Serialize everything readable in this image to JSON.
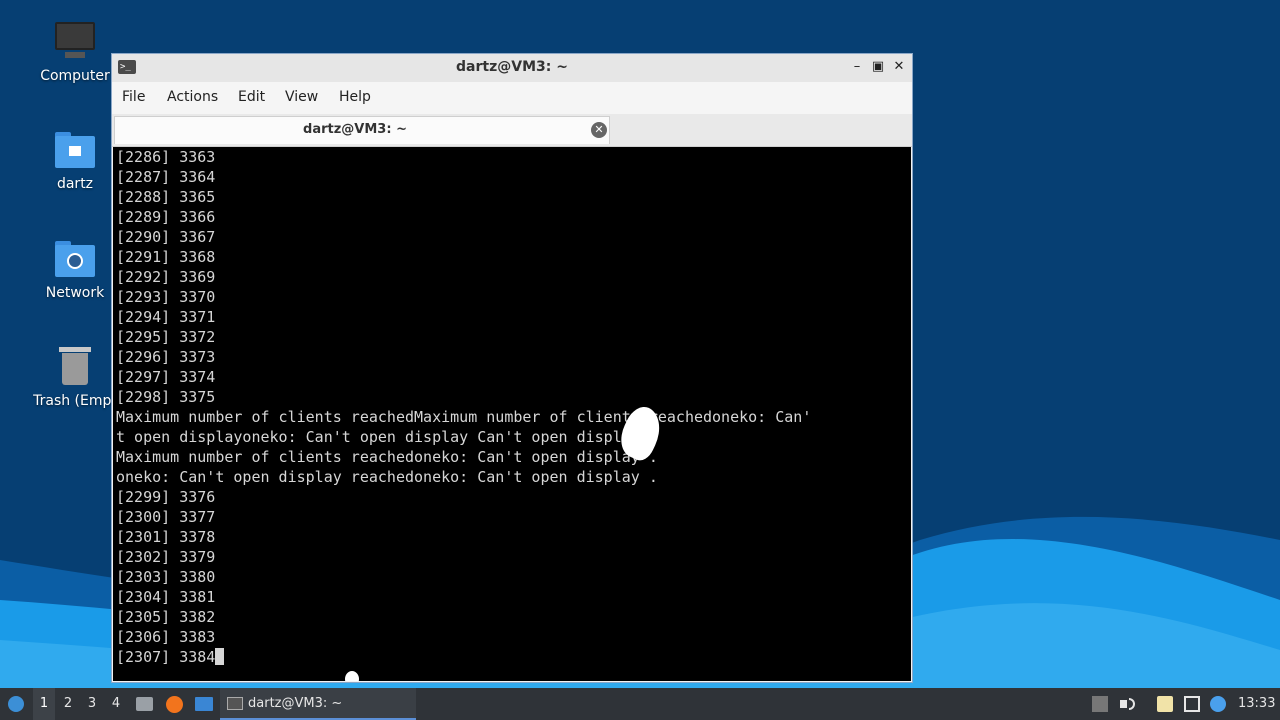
{
  "desktop": {
    "icons": [
      {
        "label": "Computer",
        "icon": "computer-icon"
      },
      {
        "label": "dartz",
        "icon": "home-folder-icon"
      },
      {
        "label": "Network",
        "icon": "network-folder-icon"
      },
      {
        "label": "Trash (Empt",
        "icon": "trash-icon"
      }
    ]
  },
  "window": {
    "title": "dartz@VM3: ~",
    "menu": [
      "File",
      "Actions",
      "Edit",
      "View",
      "Help"
    ],
    "tab_title": "dartz@VM3: ~"
  },
  "terminal": {
    "lines": [
      "[2286] 3363",
      "[2287] 3364",
      "[2288] 3365",
      "[2289] 3366",
      "[2290] 3367",
      "[2291] 3368",
      "[2292] 3369",
      "[2293] 3370",
      "[2294] 3371",
      "[2295] 3372",
      "[2296] 3373",
      "[2297] 3374",
      "[2298] 3375",
      "Maximum number of clients reachedMaximum number of clients reachedoneko: Can'",
      "t open displayoneko: Can't open display Can't open display .",
      "Maximum number of clients reachedoneko: Can't open display .",
      "oneko: Can't open display reachedoneko: Can't open display .",
      "[2299] 3376",
      "[2300] 3377",
      "[2301] 3378",
      "[2302] 3379",
      "[2303] 3380",
      "[2304] 3381",
      "[2305] 3382",
      "[2306] 3383",
      "[2307] 3384"
    ]
  },
  "taskbar": {
    "workspaces": [
      "1",
      "2",
      "3",
      "4"
    ],
    "active_workspace": "1",
    "task_label": "dartz@VM3: ~",
    "clock": "13:33"
  },
  "colors": {
    "desktop_bg": "#063f73",
    "wave_light": "#1a9be8",
    "terminal_bg": "#000000",
    "terminal_fg": "#d6d6d6",
    "taskbar_bg": "#2f3338"
  }
}
